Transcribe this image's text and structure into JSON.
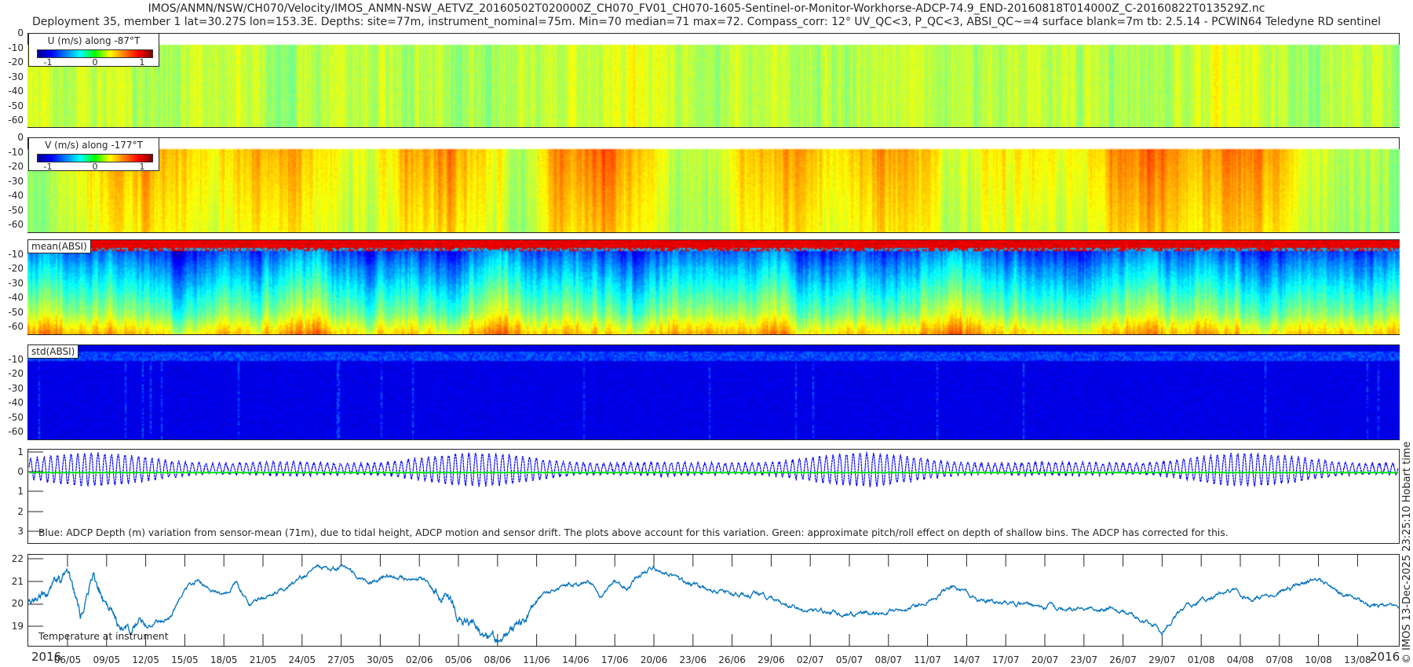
{
  "title": {
    "line1": "IMOS/ANMN/NSW/CH070/Velocity/IMOS_ANMN-NSW_AETVZ_20160502T020000Z_CH070_FV01_CH070-1605-Sentinel-or-Monitor-Workhorse-ADCP-74.9_END-20160818T014000Z_C-20160822T013529Z.nc",
    "line2": "Deployment 35, member 1 lat=30.27S lon=153.3E. Depths: site=77m, instrument_nominal=75m. Min=70 median=71 max=72. Compass_corr: 12° UV_QC<3, P_QC<3, ABSI_QC~=4 surface blank=7m tb: 2.5.14 - PCWIN64 Teledyne RD sentinel"
  },
  "side_stamp": "© IMOS 13-Dec-2025 23:25:10 Hobart time",
  "time_axis": {
    "year_left": "2016",
    "year_right": "2016",
    "tick_labels": [
      "06/05",
      "09/05",
      "12/05",
      "15/05",
      "18/05",
      "21/05",
      "24/05",
      "27/05",
      "30/05",
      "02/06",
      "05/06",
      "08/06",
      "11/06",
      "14/06",
      "17/06",
      "20/06",
      "23/06",
      "26/06",
      "29/06",
      "02/07",
      "05/07",
      "08/07",
      "11/07",
      "14/07",
      "17/07",
      "20/07",
      "23/07",
      "26/07",
      "29/07",
      "01/08",
      "04/08",
      "07/08",
      "10/08",
      "13/08"
    ]
  },
  "chart_data": [
    {
      "type": "heatmap",
      "id": "u",
      "legend_title": "U (m/s) along -87°T",
      "colorbar_ticks": [
        "-1",
        "0",
        "1"
      ],
      "clim": [
        -1.3,
        1.3
      ],
      "ylim": [
        -65,
        0
      ],
      "y_ticks": [
        "0",
        "-10",
        "-20",
        "-30",
        "-40",
        "-50",
        "-60"
      ],
      "first_bin_depth": -7,
      "mean_value_per_3_days": [
        0.1,
        0.2,
        0.2,
        0.15,
        0.1,
        0.2,
        0.15,
        0.1,
        0.25,
        0.2,
        0.15,
        0.1,
        0.1,
        0.2,
        0.15,
        0.2,
        0.25,
        0.15,
        0.1,
        0.2,
        0.15,
        0.1,
        0.15,
        0.2,
        0.1,
        0.15,
        0.2,
        0.15,
        0.1,
        0.15,
        0.2,
        0.25,
        0.15,
        0.1,
        0.1,
        0.1
      ]
    },
    {
      "type": "heatmap",
      "id": "v",
      "legend_title": "V (m/s) along -177°T",
      "colorbar_ticks": [
        "-1",
        "0",
        "1"
      ],
      "clim": [
        -1.3,
        1.3
      ],
      "ylim": [
        -65,
        0
      ],
      "y_ticks": [
        "0",
        "-10",
        "-20",
        "-30",
        "-40",
        "-50",
        "-60"
      ],
      "first_bin_depth": -7,
      "mean_value_per_3_days": [
        0.05,
        0.1,
        0.4,
        0.55,
        0.45,
        0.3,
        0.5,
        0.55,
        0.3,
        0.15,
        0.5,
        0.6,
        0.35,
        0.1,
        0.55,
        0.7,
        0.4,
        0.1,
        0.2,
        0.45,
        0.5,
        0.35,
        0.55,
        0.45,
        0.2,
        0.3,
        0.4,
        0.3,
        0.5,
        0.7,
        0.45,
        0.6,
        0.55,
        0.2,
        0.15,
        0.1
      ]
    },
    {
      "type": "heatmap",
      "id": "mean_absi",
      "label": "mean(ABSI)",
      "ylim": [
        -65,
        0
      ],
      "y_ticks": [
        "-10",
        "-20",
        "-30",
        "-40",
        "-50",
        "-60"
      ]
    },
    {
      "type": "heatmap",
      "id": "std_absi",
      "label": "std(ABSI)",
      "ylim": [
        -65,
        0
      ],
      "y_ticks": [
        "-10",
        "-20",
        "-30",
        "-40",
        "-50",
        "-60"
      ]
    },
    {
      "type": "line",
      "id": "depth",
      "ylim": [
        -3.6,
        1.15
      ],
      "y_ticks": [
        "1",
        "0",
        "1",
        "2",
        "3"
      ],
      "series": [
        {
          "name": "ADCP depth variation (m)",
          "color": "#0000ff",
          "mean": 0.15,
          "tidal_period_days": 0.5175,
          "amplitude_range": [
            0.25,
            0.85
          ]
        },
        {
          "name": "pitch/roll effect",
          "color": "#00e600",
          "value": -0.05
        }
      ],
      "annotation": "Blue: ADCP Depth (m) variation from sensor-mean (71m), due to tidal height, ADCP motion and sensor drift. The plots above account for this variation. Green: approximate pitch/roll effect on depth of shallow bins. The ADCP has corrected for this."
    },
    {
      "type": "line",
      "id": "temperature",
      "ylim": [
        18.6,
        22.2
      ],
      "y_ticks": [
        "22",
        "21",
        "20",
        "19"
      ],
      "color": "#0072bd",
      "annotation": "Temperature at instrument",
      "x": [
        "02/05",
        "04/05",
        "06/05",
        "07/05",
        "08/05",
        "09/05",
        "10/05",
        "12/05",
        "14/05",
        "15/05",
        "16/05",
        "18/05",
        "19/05",
        "20/05",
        "22/05",
        "24/05",
        "25/05",
        "27/05",
        "29/05",
        "31/05",
        "02/06",
        "04/06",
        "05/06",
        "07/06",
        "08/06",
        "10/06",
        "11/06",
        "13/06",
        "15/06",
        "16/06",
        "17/06",
        "18/06",
        "20/06",
        "22/06",
        "24/06",
        "26/06",
        "28/06",
        "30/06",
        "02/07",
        "05/07",
        "07/07",
        "09/07",
        "11/07",
        "13/07",
        "15/07",
        "17/07",
        "19/07",
        "21/07",
        "23/07",
        "25/07",
        "27/07",
        "29/07",
        "31/07",
        "02/08",
        "03/08",
        "05/08",
        "07/08",
        "10/08",
        "12/08",
        "14/08",
        "16/08",
        "17/08"
      ],
      "y": [
        20.0,
        20.4,
        21.3,
        19.5,
        21.2,
        19.8,
        19.1,
        19.0,
        19.4,
        20.8,
        21.1,
        20.3,
        21.0,
        20.0,
        20.5,
        21.2,
        21.5,
        21.6,
        21.0,
        21.3,
        21.2,
        20.5,
        19.5,
        18.6,
        18.4,
        19.0,
        20.2,
        20.8,
        21.0,
        20.3,
        21.0,
        20.8,
        21.7,
        21.0,
        20.6,
        20.5,
        20.4,
        20.0,
        19.7,
        19.6,
        19.6,
        19.7,
        20.2,
        20.8,
        20.2,
        20.1,
        19.9,
        19.9,
        19.7,
        19.8,
        19.5,
        18.8,
        20.0,
        20.3,
        20.8,
        20.2,
        20.6,
        21.1,
        20.3,
        20.0,
        19.9,
        19.5
      ]
    }
  ]
}
